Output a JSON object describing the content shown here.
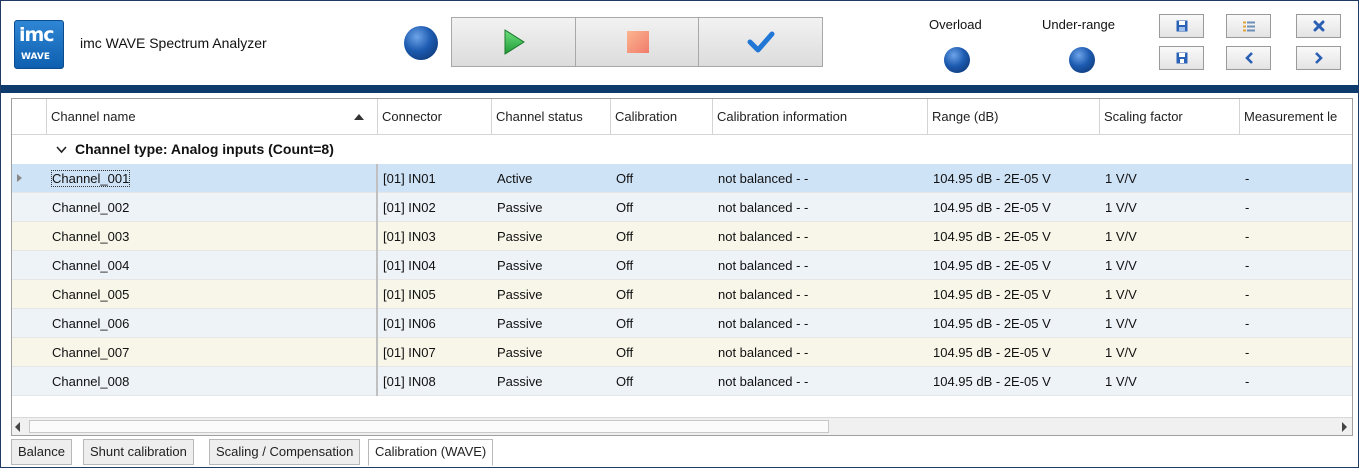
{
  "app": {
    "logo_line1": "imc",
    "logo_line2": "WAVE",
    "title": "imc WAVE Spectrum Analyzer"
  },
  "toolbar": {
    "status_led": "blue",
    "start_button_icon": "play-icon",
    "stop_button_icon": "stop-icon",
    "confirm_button_icon": "checkmark-icon"
  },
  "indicators": {
    "overload_label": "Overload",
    "underrange_label": "Under-range"
  },
  "nav_buttons": {
    "save": "save-icon",
    "list": "list-icon",
    "close": "close-icon",
    "save_as": "save-as-icon",
    "prev": "chevron-left-icon",
    "next": "chevron-right-icon"
  },
  "colors": {
    "header_bar": "#0d3b6e",
    "row_selected": "#cfe3f7",
    "row_even": "#eef3f8",
    "row_odd": "#f8f6e8",
    "play_green": "#2db84a",
    "check_blue": "#2177d6",
    "stop_orange": "#f49a7b"
  },
  "grid": {
    "columns": [
      "Channel name",
      "Connector",
      "Channel status",
      "Calibration",
      "Calibration information",
      "Range (dB)",
      "Scaling factor",
      "Measurement le"
    ],
    "sorted_column": "Channel name",
    "group_label": "Channel type: Analog inputs (Count=8)",
    "rows": [
      [
        "Channel_001",
        "[01] IN01",
        "Active",
        "Off",
        "not balanced - -",
        "104.95 dB - 2E-05 V",
        "1 V/V",
        "-"
      ],
      [
        "Channel_002",
        "[01] IN02",
        "Passive",
        "Off",
        "not balanced - -",
        "104.95 dB - 2E-05 V",
        "1 V/V",
        "-"
      ],
      [
        "Channel_003",
        "[01] IN03",
        "Passive",
        "Off",
        "not balanced - -",
        "104.95 dB - 2E-05 V",
        "1 V/V",
        "-"
      ],
      [
        "Channel_004",
        "[01] IN04",
        "Passive",
        "Off",
        "not balanced - -",
        "104.95 dB - 2E-05 V",
        "1 V/V",
        "-"
      ],
      [
        "Channel_005",
        "[01] IN05",
        "Passive",
        "Off",
        "not balanced - -",
        "104.95 dB - 2E-05 V",
        "1 V/V",
        "-"
      ],
      [
        "Channel_006",
        "[01] IN06",
        "Passive",
        "Off",
        "not balanced - -",
        "104.95 dB - 2E-05 V",
        "1 V/V",
        "-"
      ],
      [
        "Channel_007",
        "[01] IN07",
        "Passive",
        "Off",
        "not balanced - -",
        "104.95 dB - 2E-05 V",
        "1 V/V",
        "-"
      ],
      [
        "Channel_008",
        "[01] IN08",
        "Passive",
        "Off",
        "not balanced - -",
        "104.95 dB - 2E-05 V",
        "1 V/V",
        "-"
      ]
    ]
  },
  "tabs": [
    "Balance",
    "Shunt calibration",
    "Scaling / Compensation",
    "Calibration (WAVE)"
  ],
  "active_tab": "Calibration (WAVE)"
}
